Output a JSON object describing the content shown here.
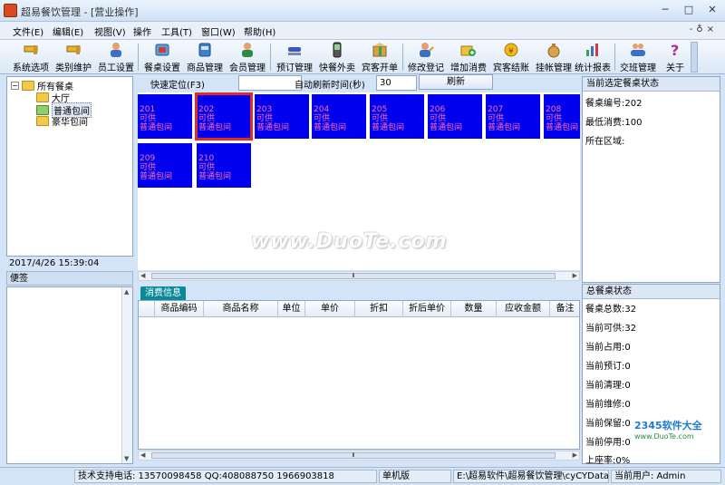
{
  "window": {
    "title": "超易餐饮管理 - [营业操作]"
  },
  "menu": [
    "文件(E)",
    "编辑(E)",
    "视图(V)",
    "操作",
    "工具(T)",
    "窗口(W)",
    "帮助(H)"
  ],
  "toolbar": [
    {
      "label": "系统选项",
      "icon": "key-icon"
    },
    {
      "label": "类别维护",
      "icon": "key-icon"
    },
    {
      "label": "员工设置",
      "icon": "person-icon"
    },
    {
      "label": "餐桌设置",
      "icon": "table-icon"
    },
    {
      "label": "商品管理",
      "icon": "goods-icon"
    },
    {
      "label": "会员管理",
      "icon": "member-icon"
    },
    {
      "label": "预订管理",
      "icon": "stapler-icon"
    },
    {
      "label": "快餐外卖",
      "icon": "phone-icon"
    },
    {
      "label": "宾客开单",
      "icon": "box-icon"
    },
    {
      "label": "修改登记",
      "icon": "edit-person-icon"
    },
    {
      "label": "增加消费",
      "icon": "add-folder-icon"
    },
    {
      "label": "宾客结账",
      "icon": "coin-icon"
    },
    {
      "label": "挂帐管理",
      "icon": "money-bag-icon"
    },
    {
      "label": "统计报表",
      "icon": "chart-icon"
    },
    {
      "label": "交班管理",
      "icon": "people-icon"
    },
    {
      "label": "关于",
      "icon": "help-icon"
    }
  ],
  "tree": {
    "root": "所有餐桌",
    "children": [
      "大厅",
      "普通包间",
      "豪华包间"
    ],
    "selected": "普通包间"
  },
  "clock": "2017/4/26 15:39:04",
  "memo": {
    "label": "便签"
  },
  "quickbar": {
    "locate_label": "快速定位(F3)",
    "locate_value": "",
    "refresh_interval_label": "自动刷新时间(秒)",
    "refresh_interval_value": "30",
    "refresh_button": "刷新"
  },
  "tables": [
    {
      "number": "201",
      "status": "可供",
      "area": "普通包间"
    },
    {
      "number": "202",
      "status": "可供",
      "area": "普通包间",
      "selected": true
    },
    {
      "number": "203",
      "status": "可供",
      "area": "普通包间"
    },
    {
      "number": "204",
      "status": "可供",
      "area": "普通包间"
    },
    {
      "number": "205",
      "status": "可供",
      "area": "普通包间"
    },
    {
      "number": "206",
      "status": "可供",
      "area": "普通包间"
    },
    {
      "number": "207",
      "status": "可供",
      "area": "普通包间"
    },
    {
      "number": "208",
      "status": "可供",
      "area": "普通包间"
    },
    {
      "number": "209",
      "status": "可供",
      "area": "普通包间"
    },
    {
      "number": "210",
      "status": "可供",
      "area": "普通包间"
    }
  ],
  "watermark": "www.DuoTe.com",
  "consume": {
    "tab": "消费信息",
    "columns": [
      "商品编码",
      "商品名称",
      "单位",
      "单价",
      "折扣",
      "折后单价",
      "数量",
      "应收金额",
      "备注"
    ]
  },
  "current_table": {
    "header": "当前选定餐桌状态",
    "lines": [
      "餐桌编号:202",
      "最低消费:100",
      "所在区域:"
    ]
  },
  "overall": {
    "header": "总餐桌状态",
    "lines": [
      "餐桌总数:32",
      "当前可供:32",
      "当前占用:0",
      "当前预订:0",
      "当前清理:0",
      "当前维修:0",
      "当前保留:0",
      "当前停用:0",
      "上座率:0%"
    ]
  },
  "corner_watermark": {
    "brand": "2345软件大全",
    "url": "www.DuoTe.com"
  },
  "status": {
    "support": "技术支持电话: 13570098458 QQ:408088750 1966903818",
    "edition": "单机版",
    "path": "E:\\超易软件\\超易餐饮管理\\cyCYData.sys",
    "user": "当前用户: Admin"
  },
  "colors": {
    "tile_bg": "#0000ee",
    "tile_text": "#ff6fb0",
    "selected_border": "#e32a2a",
    "tab_bg": "#0a8a98"
  }
}
